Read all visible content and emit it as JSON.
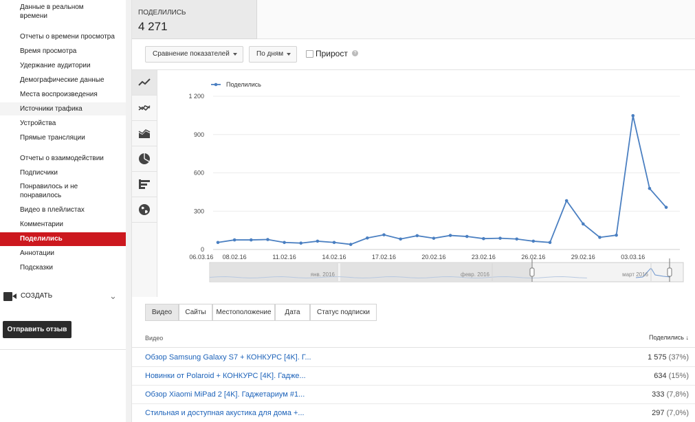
{
  "sidebar": {
    "items": [
      {
        "label": "Данные в реальном\nвремени"
      },
      {
        "label": "Отчеты о времени просмотра"
      },
      {
        "label": "Время просмотра"
      },
      {
        "label": "Удержание аудитории"
      },
      {
        "label": "Демографические данные"
      },
      {
        "label": "Места воспроизведения"
      },
      {
        "label": "Источники трафика"
      },
      {
        "label": "Устройства"
      },
      {
        "label": "Прямые трансляции"
      },
      {
        "label": "Отчеты о взаимодействии"
      },
      {
        "label": "Подписчики"
      },
      {
        "label": "Понравилось и не\nпонравилось"
      },
      {
        "label": "Видео в плейлистах"
      },
      {
        "label": "Комментарии"
      },
      {
        "label": "Поделились"
      },
      {
        "label": "Аннотации"
      },
      {
        "label": "Подсказки"
      }
    ],
    "active_index": 14,
    "create_label": "СОЗДАТЬ",
    "feedback_label": "Отправить отзыв"
  },
  "metric": {
    "title": "ПОДЕЛИЛИСЬ",
    "value": "4 271"
  },
  "controls": {
    "compare_label": "Сравнение показателей",
    "period_label": "По дням",
    "growth_label": "Прирост",
    "growth_checked": false
  },
  "chart_data": {
    "type": "line",
    "series": [
      {
        "name": "Поделились",
        "color": "#4a7fc1",
        "values": [
          55,
          75,
          75,
          78,
          55,
          50,
          65,
          55,
          40,
          90,
          115,
          82,
          108,
          88,
          110,
          102,
          85,
          88,
          82,
          65,
          55,
          382,
          200,
          95,
          112,
          1048,
          478,
          330
        ]
      }
    ],
    "x": [
      "07.02.16",
      "08.02.16",
      "09.02.16",
      "10.02.16",
      "11.02.16",
      "12.02.16",
      "13.02.16",
      "14.02.16",
      "15.02.16",
      "16.02.16",
      "17.02.16",
      "18.02.16",
      "19.02.16",
      "20.02.16",
      "21.02.16",
      "22.02.16",
      "23.02.16",
      "24.02.16",
      "25.02.16",
      "26.02.16",
      "27.02.16",
      "28.02.16",
      "29.02.16",
      "01.03.16",
      "02.03.16",
      "03.03.16",
      "04.03.16",
      "05.03.16"
    ],
    "x_tick_labels": [
      "08.02.16",
      "11.02.16",
      "14.02.16",
      "17.02.16",
      "20.02.16",
      "23.02.16",
      "26.02.16",
      "29.02.16",
      "03.03.16",
      "06.03.16"
    ],
    "y_tick_labels": [
      "0",
      "300",
      "600",
      "900",
      "1 200"
    ],
    "ylim": [
      0,
      1200
    ],
    "legend_label": "Поделились",
    "legend_position": "top-left",
    "grid": true,
    "overview_labels": [
      "янв. 2016",
      "февр. 2016",
      "март 2016"
    ]
  },
  "tabs": [
    {
      "label": "Видео"
    },
    {
      "label": "Сайты"
    },
    {
      "label": "Местоположение"
    },
    {
      "label": "Дата"
    },
    {
      "label": "Статус подписки"
    }
  ],
  "table": {
    "col_video": "Видео",
    "col_shares": "Поделились",
    "rows": [
      {
        "title": "Обзор Samsung Galaxy S7 + КОНКУРС [4K]. Г...",
        "value": "1 575",
        "pct": "(37%)"
      },
      {
        "title": "Новинки от Polaroid + КОНКУРС [4K]. Гадже...",
        "value": "634",
        "pct": "(15%)"
      },
      {
        "title": "Обзор Xiaomi MiPad 2 [4K]. Гаджетариум #1...",
        "value": "333",
        "pct": "(7,8%)"
      },
      {
        "title": "Стильная и доступная акустика для дома +...",
        "value": "297",
        "pct": "(7,0%)"
      }
    ]
  }
}
